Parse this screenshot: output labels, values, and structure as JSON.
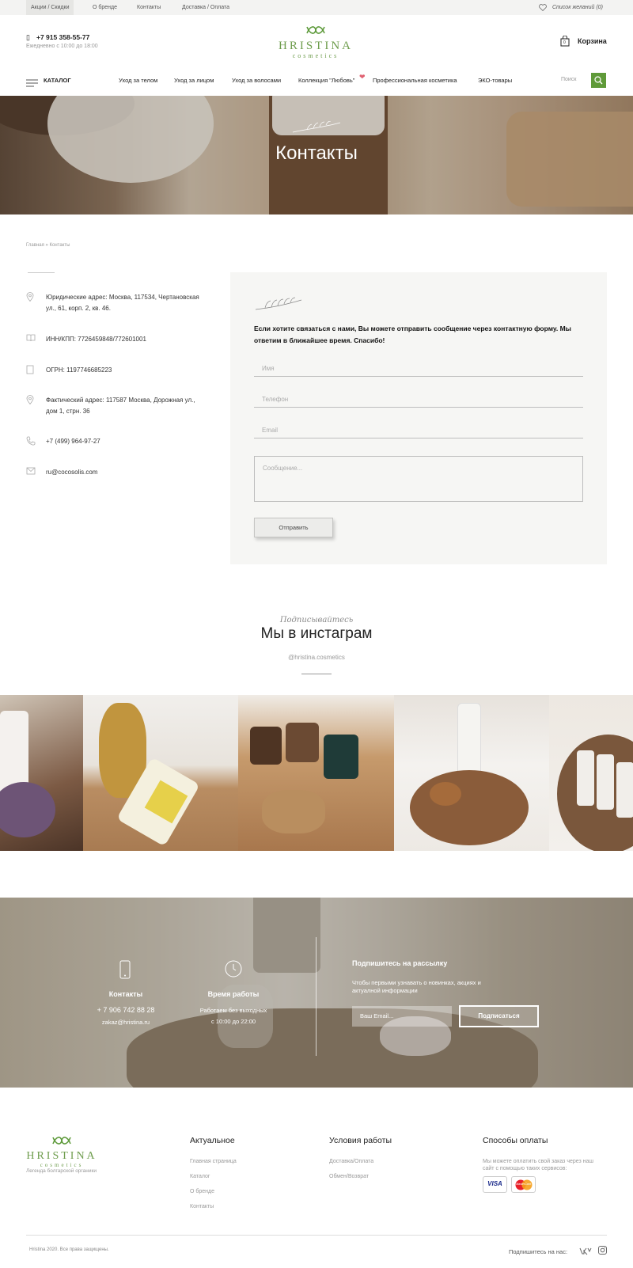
{
  "topbar": {
    "links": [
      "Акции / Скидки",
      "О бренде",
      "Контакты",
      "Доставка / Оплата"
    ],
    "wishlist": "Список желаний (0)"
  },
  "header": {
    "phone": "+7 915 358-55-77",
    "hours": "Ежедневно с 10:00 до 18:00",
    "logo_name": "HRISTINA",
    "logo_sub": "cosmetics",
    "cart_label": "Корзина",
    "cart_count": "0"
  },
  "nav": {
    "catalog": "КАТАЛОГ",
    "items": [
      "Уход за телом",
      "Уход за лицом",
      "Уход за волосами",
      "Коллекция \"Любовь\"",
      "Профессиональная косметика",
      "ЭКО-товары"
    ],
    "search_placeholder": "Поиск"
  },
  "hero": {
    "title": "Контакты"
  },
  "breadcrumb": "Главная » Контакты",
  "contacts": [
    {
      "icon": "location-pin-icon",
      "text": "Юридические адрес: Москва, 117534, Чертановская ул., 61, корп. 2, кв. 46."
    },
    {
      "icon": "book-icon",
      "text": "ИНН/КПП: 7726459848/772601001"
    },
    {
      "icon": "document-icon",
      "text": "ОГРН: 1197746685223"
    },
    {
      "icon": "location-pin-icon",
      "text": "Фактический адрес: 117587 Москва, Дорожная ул., дом 1, стрн. 36"
    },
    {
      "icon": "phone-icon",
      "text": "+7 (499) 964-97-27"
    },
    {
      "icon": "mail-icon",
      "text": "ru@cocosolis.com"
    }
  ],
  "form": {
    "intro": "Если хотите связаться с нами, Вы можете отправить сообщение через контактную форму. Мы ответим в ближайшее время. Спасибо!",
    "name_placeholder": "Имя",
    "phone_placeholder": "Телефон",
    "email_placeholder": "Email",
    "message_placeholder": "Сообщение...",
    "submit": "Отправить"
  },
  "instagram": {
    "script": "Подписывайтесь",
    "title": "Мы в инстаграм",
    "handle": "@hristina.cosmetics"
  },
  "band": {
    "contacts_title": "Контакты",
    "contacts_phone": "+ 7 906 742 88 28",
    "contacts_email": "zakaz@hristina.ru",
    "hours_title": "Время работы",
    "hours_line1": "Работаем без выходных",
    "hours_line2": "с 10:00 до 22:00",
    "subscribe_title": "Подпишитесь на рассылку",
    "subscribe_desc": "Чтобы первыми узнавать о новинках, акциях и актуалной информации",
    "email_placeholder": "Ваш Email...",
    "subscribe_button": "Подписаться"
  },
  "footer": {
    "tagline": "Легенда болгарской органики",
    "col1_title": "Актуальное",
    "col1_links": [
      "Главная страница",
      "Каталог",
      "О бренде",
      "Контакты"
    ],
    "col2_title": "Условия работы",
    "col2_links": [
      "Доставка/Оплата",
      "Обмен/Возврат"
    ],
    "col3_title": "Способы оплаты",
    "col3_desc": "Мы можете оплатить свой заказ через наш сайт с помощью таких сервисов:",
    "card1": "VISA",
    "card2": "MasterCard",
    "copyright": "Hristina 2020. Все права защищены.",
    "follow": "Подпишитесь на нас:"
  },
  "colors": {
    "accent": "#5f9a39",
    "form_bg": "#f6f6f4",
    "topbar_bg": "#f3f3f2"
  }
}
